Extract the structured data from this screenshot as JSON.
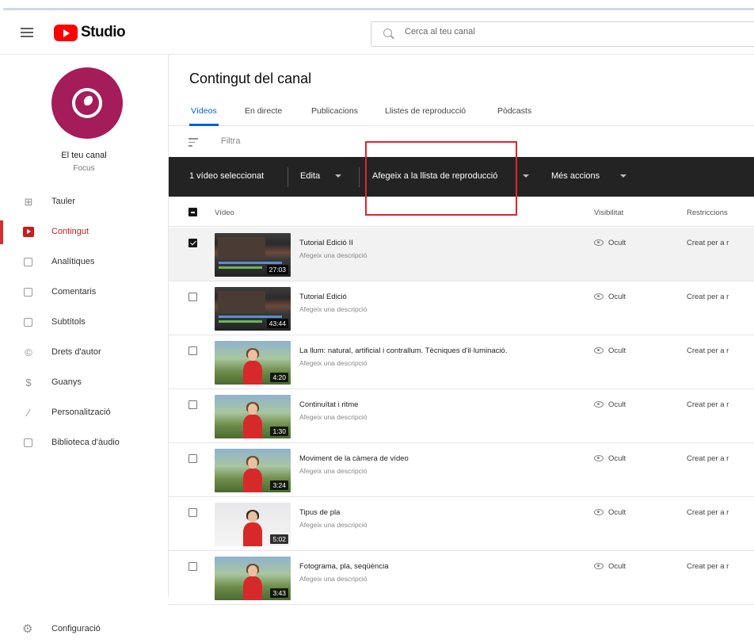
{
  "app": {
    "studio_label": "Studio",
    "search_placeholder": "Cerca al teu canal"
  },
  "channel": {
    "name": "El teu canal",
    "subtitle": "Focus",
    "avatar_color": "#a51c5a"
  },
  "sidebar": {
    "items": [
      {
        "label": "Tauler",
        "icon": "dashboard-icon"
      },
      {
        "label": "Contingut",
        "icon": "content-icon",
        "active": true
      },
      {
        "label": "Analítiques",
        "icon": "analytics-icon"
      },
      {
        "label": "Comentaris",
        "icon": "comments-icon"
      },
      {
        "label": "Subtítols",
        "icon": "subtitles-icon"
      },
      {
        "label": "Drets d'autor",
        "icon": "copyright-icon"
      },
      {
        "label": "Guanys",
        "icon": "dollar-icon"
      },
      {
        "label": "Personalització",
        "icon": "magic-wand-icon"
      },
      {
        "label": "Biblioteca d'àudio",
        "icon": "audio-library-icon"
      }
    ],
    "settings_label": "Configuració"
  },
  "main": {
    "title": "Contingut del canal",
    "tabs": [
      "Vídeos",
      "En directe",
      "Publicacions",
      "Llistes de reproducció",
      "Pòdcasts"
    ],
    "filter_label": "Filtra",
    "action_bar": {
      "selected_count_label": "1 vídeo seleccionat",
      "edit_label": "Edita",
      "add_to_playlist_label": "Afegeix a la llista de reproducció",
      "more_actions_label": "Més accions"
    },
    "columns": {
      "video": "Vídeo",
      "visibility": "Visibilitat",
      "restrictions": "Restriccions"
    },
    "rows": [
      {
        "title": "Tutorial Edició II",
        "description": "Afegeix una descripció",
        "duration": "27:03",
        "visibility": "Ocult",
        "restrictions": "Creat per a r",
        "selected": true,
        "thumb": "editor"
      },
      {
        "title": "Tutorial Edició",
        "description": "Afegeix una descripció",
        "duration": "43:44",
        "visibility": "Ocult",
        "restrictions": "Creat per a r",
        "selected": false,
        "thumb": "editor"
      },
      {
        "title": "La llum: natural, artificial i contrallum. Tècniques d'il·luminació.",
        "description": "Afegeix una descripció",
        "duration": "4:20",
        "visibility": "Ocult",
        "restrictions": "Creat per a r",
        "selected": false,
        "thumb": "outdoor"
      },
      {
        "title": "Continuïtat i ritme",
        "description": "Afegeix una descripció",
        "duration": "1:30",
        "visibility": "Ocult",
        "restrictions": "Creat per a r",
        "selected": false,
        "thumb": "outdoor"
      },
      {
        "title": "Moviment de la càmera de vídeo",
        "description": "Afegeix una descripció",
        "duration": "3:24",
        "visibility": "Ocult",
        "restrictions": "Creat per a r",
        "selected": false,
        "thumb": "outdoor"
      },
      {
        "title": "Tipus de pla",
        "description": "Afegeix una descripció",
        "duration": "5:02",
        "visibility": "Ocult",
        "restrictions": "Creat per a r",
        "selected": false,
        "thumb": "white"
      },
      {
        "title": "Fotograma, pla, seqüència",
        "description": "Afegeix una descripció",
        "duration": "3:43",
        "visibility": "Ocult",
        "restrictions": "Creat per a r",
        "selected": false,
        "thumb": "outdoor"
      }
    ]
  },
  "colors": {
    "accent": "#065fd4",
    "brand": "#ff0000",
    "active_nav": "#c41e1e",
    "action_bar": "#232323",
    "highlight_box": "#e3242b"
  }
}
